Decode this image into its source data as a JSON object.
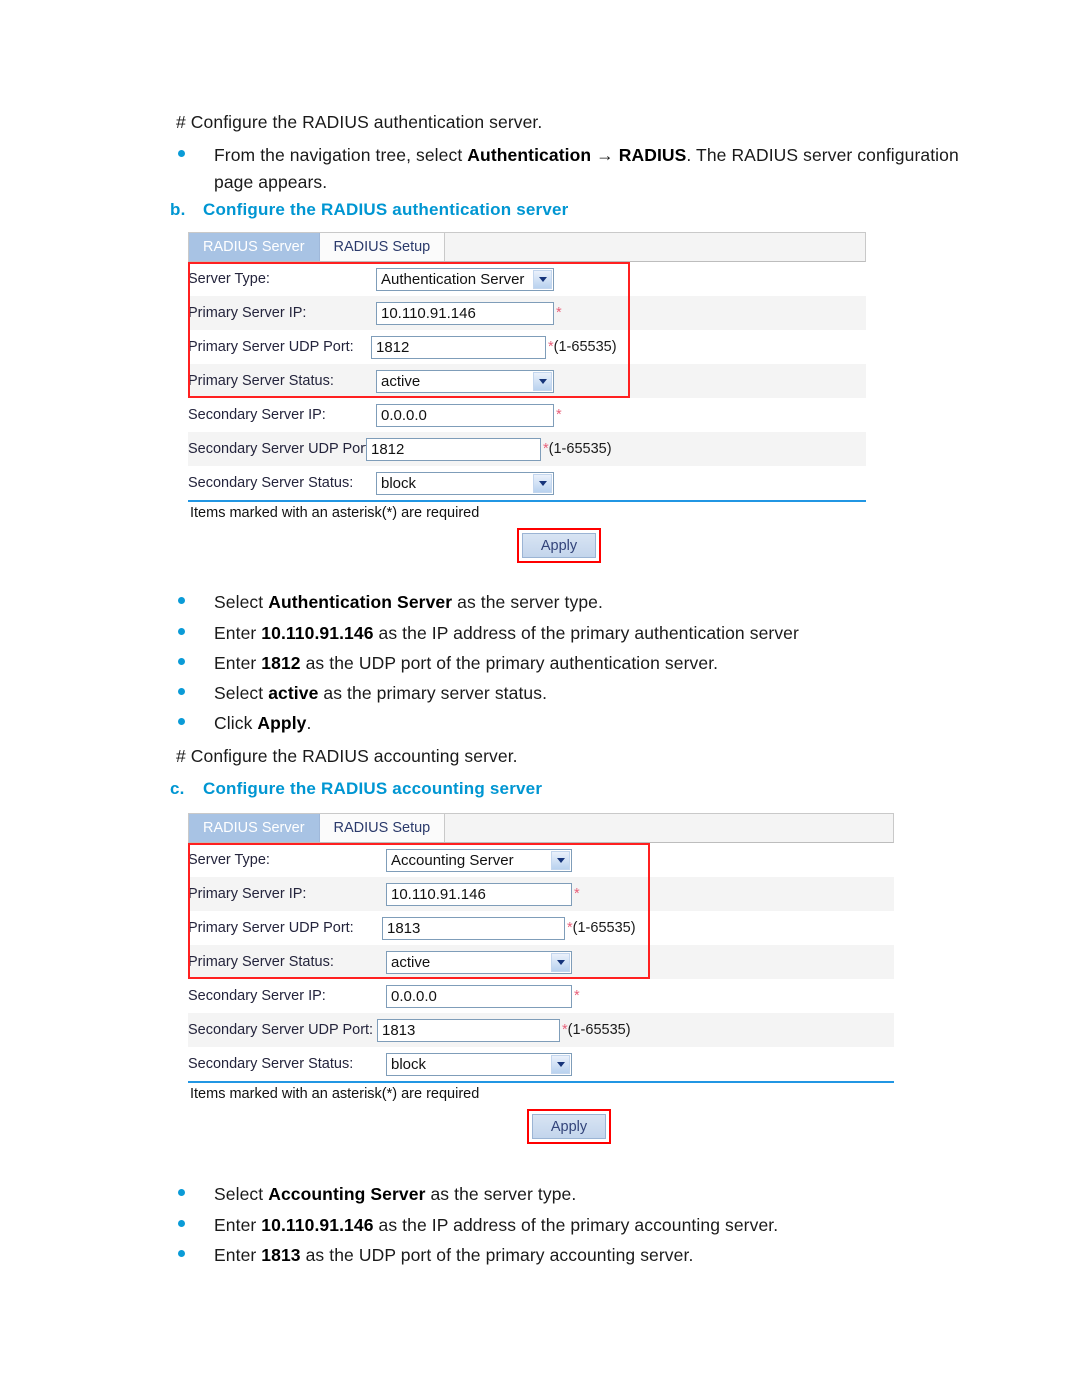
{
  "document": {
    "intro_1": "# Configure the RADIUS authentication server.",
    "bullet_nav": {
      "pre": "From the navigation tree, select ",
      "b1": "Authentication",
      "arrow": " → ",
      "b2": "RADIUS",
      "post": ". The RADIUS server configuration page appears."
    },
    "step_b": {
      "lead": "b.",
      "text": "Configure the RADIUS authentication server"
    },
    "step_c": {
      "lead": "c.",
      "text": "Configure the RADIUS accounting server"
    },
    "intro_2": "# Configure the RADIUS accounting server.",
    "auth_steps": [
      {
        "pre": "Select ",
        "strong": "Authentication Server",
        "post": " as the server type."
      },
      {
        "pre": "Enter ",
        "strong": "10.110.91.146",
        "post": " as the IP address of the primary authentication server"
      },
      {
        "pre": "Enter ",
        "strong": "1812",
        "post": " as the UDP port of the primary authentication server."
      },
      {
        "pre": "Select ",
        "strong": "active",
        "post": " as the primary server status."
      },
      {
        "pre": "Click ",
        "strong": "Apply",
        "post": "."
      }
    ],
    "acct_steps": [
      {
        "pre": "Select ",
        "strong": "Accounting Server",
        "post": " as the server type."
      },
      {
        "pre": "Enter ",
        "strong": "10.110.91.146",
        "post": " as the IP address of the primary accounting server."
      },
      {
        "pre": "Enter ",
        "strong": "1813",
        "post": " as the UDP port of the primary accounting server."
      }
    ]
  },
  "auth_panel": {
    "tabs": [
      {
        "label": "RADIUS Server",
        "active": true
      },
      {
        "label": "RADIUS Setup",
        "active": false
      }
    ],
    "rows": [
      {
        "label": "Server Type:",
        "control": "select",
        "value": "Authentication Server",
        "hint": ""
      },
      {
        "label": "Primary Server IP:",
        "control": "text",
        "value": "10.110.91.146",
        "hint": "*"
      },
      {
        "label": "Primary Server UDP Port:",
        "control": "text",
        "value": "1812",
        "hint": "*(1-65535)"
      },
      {
        "label": "Primary Server Status:",
        "control": "select",
        "value": "active",
        "hint": ""
      },
      {
        "label": "Secondary Server IP:",
        "control": "text",
        "value": "0.0.0.0",
        "hint": "*"
      },
      {
        "label": "Secondary Server UDP Port:",
        "control": "text",
        "value": "1812",
        "hint": "*(1-65535)"
      },
      {
        "label": "Secondary Server Status:",
        "control": "select",
        "value": "block",
        "hint": ""
      }
    ],
    "required_note": "Items marked with an asterisk(*) are required",
    "apply_label": "Apply"
  },
  "acct_panel": {
    "tabs": [
      {
        "label": "RADIUS Server",
        "active": true
      },
      {
        "label": "RADIUS Setup",
        "active": false
      }
    ],
    "rows": [
      {
        "label": "Server Type:",
        "control": "select",
        "value": "Accounting Server",
        "hint": ""
      },
      {
        "label": "Primary Server IP:",
        "control": "text",
        "value": "10.110.91.146",
        "hint": "*"
      },
      {
        "label": "Primary Server UDP Port:",
        "control": "text",
        "value": "1813",
        "hint": "*(1-65535)"
      },
      {
        "label": "Primary Server Status:",
        "control": "select",
        "value": "active",
        "hint": ""
      },
      {
        "label": "Secondary Server IP:",
        "control": "text",
        "value": "0.0.0.0",
        "hint": "*"
      },
      {
        "label": "Secondary Server UDP Port:",
        "control": "text",
        "value": "1813",
        "hint": "*(1-65535)"
      },
      {
        "label": "Secondary Server Status:",
        "control": "select",
        "value": "block",
        "hint": ""
      }
    ],
    "required_note": "Items marked with an asterisk(*) are required",
    "apply_label": "Apply"
  },
  "colors": {
    "heading": "#0096d2",
    "bullet": "#0a9bd7",
    "highlight_box": "#ff2020",
    "tab_active_bg": "#a8c3e4",
    "separator": "#2196e3",
    "asterisk": "#e8607a"
  }
}
